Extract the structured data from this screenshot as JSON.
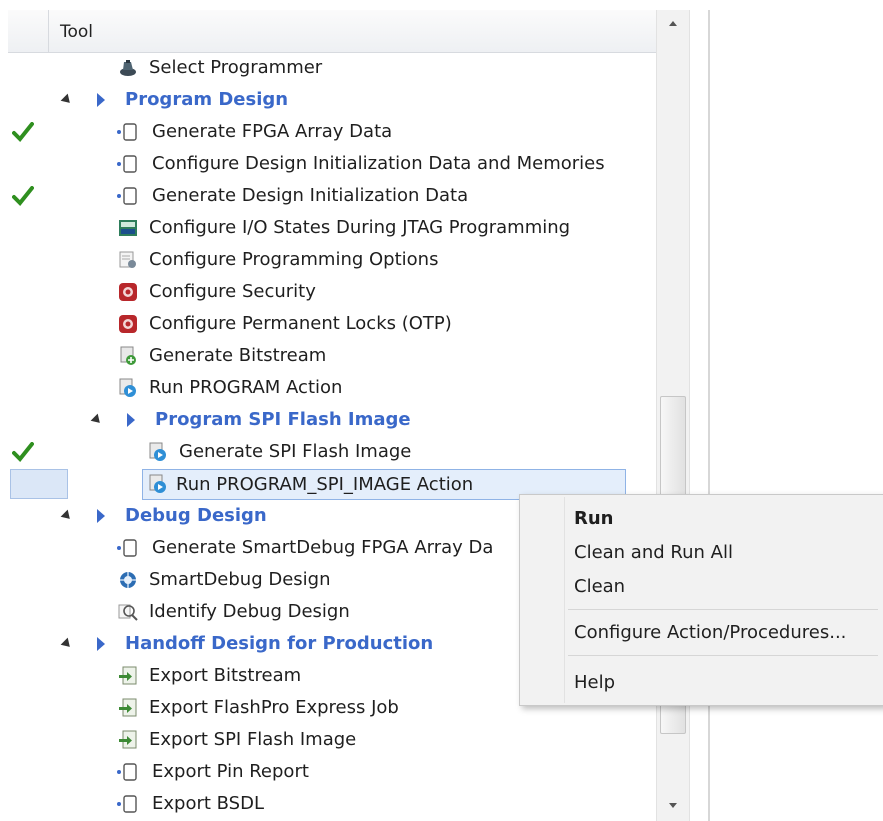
{
  "header": {
    "title": "Tool"
  },
  "tree": [
    {
      "label": "Select Programmer"
    },
    {
      "label": "Program Design"
    },
    {
      "label": "Generate FPGA Array Data"
    },
    {
      "label": "Configure Design Initialization Data and Memories"
    },
    {
      "label": "Generate Design Initialization Data"
    },
    {
      "label": "Configure I/O States During JTAG Programming"
    },
    {
      "label": "Configure Programming Options"
    },
    {
      "label": "Configure Security"
    },
    {
      "label": "Configure Permanent Locks (OTP)"
    },
    {
      "label": "Generate Bitstream"
    },
    {
      "label": "Run PROGRAM Action"
    },
    {
      "label": "Program SPI Flash Image"
    },
    {
      "label": "Generate SPI Flash Image"
    },
    {
      "label": "Run PROGRAM_SPI_IMAGE Action"
    },
    {
      "label": "Debug Design"
    },
    {
      "label": "Generate SmartDebug FPGA Array Da"
    },
    {
      "label": "SmartDebug Design"
    },
    {
      "label": "Identify Debug Design"
    },
    {
      "label": "Handoff Design for Production"
    },
    {
      "label": "Export Bitstream"
    },
    {
      "label": "Export FlashPro Express Job"
    },
    {
      "label": "Export SPI Flash Image"
    },
    {
      "label": "Export Pin Report"
    },
    {
      "label": "Export BSDL"
    }
  ],
  "context_menu": {
    "items": [
      {
        "label": "Run"
      },
      {
        "label": "Clean and Run All"
      },
      {
        "label": "Clean"
      },
      {
        "label": "Configure Action/Procedures..."
      },
      {
        "label": "Help"
      }
    ]
  },
  "colors": {
    "group_text": "#3a68c9",
    "check_green": "#2f8f1f",
    "selection_bg": "#e4eefb",
    "selection_border": "#8fb3e6",
    "menu_bg": "#f2f2f2"
  },
  "icons": {
    "select_programmer": "programmer-icon",
    "doc": "document-icon",
    "io_states": "io-chip-icon",
    "programming_options": "options-icon",
    "security": "security-shield-icon",
    "bitstream": "bitstream-icon",
    "run": "run-action-icon",
    "smartdebug": "smartdebug-icon",
    "identify": "identify-icon",
    "export": "export-icon",
    "status": "checkmark-icon"
  }
}
